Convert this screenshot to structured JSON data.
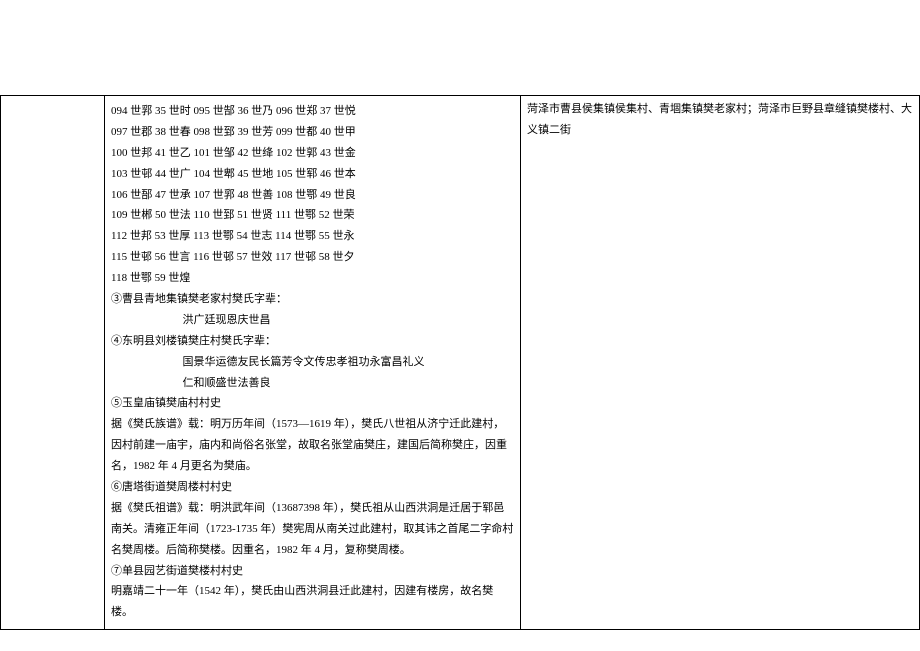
{
  "middle": {
    "gen_lines": [
      "094 世郛 35 世时 095 世郜 36 世乃 096 世郑 37 世悦",
      "097 世郡 38 世春 098 世郅 39 世芳 099 世都 40 世甲",
      "100 世邦 41 世乙 101 世邹 42 世绛 102 世郭 43 世金",
      "103 世邨 44 世广 104 世郫 45 世地 105 世郓 46 世本",
      "106 世郚 47 世承 107 世郛 48 世善 108 世鄂 49 世良",
      "109 世郴 50 世法 110 世郅 51 世贤 111 世鄂 52 世荣",
      "112 世邦 53 世厚 113 世鄂 54 世志 114 世鄂 55 世永",
      "115 世邨 56 世言 116 世邨 57 世效 117 世邨 58 世夕",
      "118 世鄂 59 世煌"
    ],
    "item3_title": "③曹县青地集镇樊老家村樊氏字辈：",
    "item3_line": "洪广廷现恩庆世昌",
    "item4_title": "④东明县刘楼镇樊庄村樊氏字辈：",
    "item4_line1": "国景华运德友民长篇芳令文传忠孝祖功永富昌礼义",
    "item4_line2": "仁和顺盛世法善良",
    "item5_title": "⑤玉皇庙镇樊庙村村史",
    "item5_p1": "据《樊氏族谱》载：明万历年间（1573—1619 年），樊氏八世祖从济宁迁此建村，因村前建一庙宇，庙内和尚俗名张堂，故取名张堂庙樊庄，建国后简称樊庄，因重名，1982 年 4 月更名为樊庙。",
    "item6_title": "⑥唐塔街道樊周楼村村史",
    "item6_p1": "据《樊氏祖谱》载：明洪武年间（13687398 年），樊氏祖从山西洪洞是迁居于郓邑南关。清雍正年间（1723-1735 年）樊宪周从南关过此建村，取其讳之首尾二字命村名樊周楼。后简称樊楼。因重名，1982 年 4 月，复称樊周楼。",
    "item7_title": "⑦单县园艺街道樊楼村村史",
    "item7_p1": "明嘉靖二十一年（1542 年），樊氏由山西洪洞县迁此建村，因建有楼房，故名樊楼。"
  },
  "right": {
    "text": "菏泽市曹县侯集镇侯集村、青堌集镇樊老家村；菏泽市巨野县章缝镇樊楼村、大义镇二街"
  }
}
